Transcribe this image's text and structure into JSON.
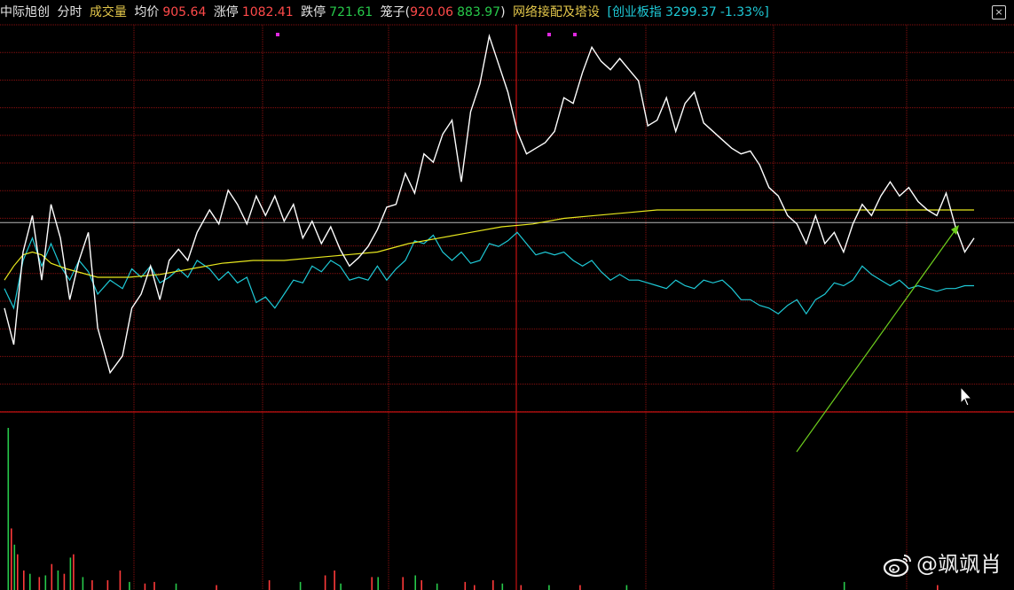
{
  "header": {
    "stock_name": "中际旭创",
    "tab_time": "分时",
    "tab_volume": "成交量",
    "avg_label": "均价",
    "avg_value": "905.64",
    "limit_up_label": "涨停",
    "limit_up_value": "1082.41",
    "limit_down_label": "跌停",
    "limit_down_value": "721.61",
    "cage_label": "笼子(",
    "cage_high": "920.06",
    "cage_low": "883.97",
    "cage_close": ")",
    "sector": "网络接配及塔设",
    "index_open": "[",
    "index_name": "创业板指",
    "index_value": "3299.37",
    "index_change": "-1.33%",
    "index_close": "]"
  },
  "colors": {
    "background": "#000000",
    "grid": "#8a1010",
    "price_line": "#ffffff",
    "avg_line": "#e8e81e",
    "index_line": "#1ec9d6",
    "vol_up": "#ff3a3a",
    "vol_down": "#27c94a",
    "arrow": "#6ecf1e",
    "marker": "#e028e0"
  },
  "chart_data": {
    "type": "line",
    "title": "",
    "xlabel": "",
    "ylabel": "",
    "grid": true,
    "x_count": 240,
    "y_range_price": [
      858,
      996
    ],
    "prev_close": 925.5,
    "series": [
      {
        "name": "",
        "kind": "price",
        "points": [
          [
            0,
            895
          ],
          [
            3,
            882
          ],
          [
            6,
            915
          ],
          [
            9,
            928
          ],
          [
            12,
            905
          ],
          [
            15,
            932
          ],
          [
            18,
            920
          ],
          [
            21,
            898
          ],
          [
            24,
            912
          ],
          [
            27,
            922
          ],
          [
            30,
            888
          ],
          [
            34,
            872
          ],
          [
            38,
            878
          ],
          [
            41,
            895
          ],
          [
            44,
            900
          ],
          [
            47,
            910
          ],
          [
            50,
            898
          ],
          [
            53,
            912
          ],
          [
            56,
            916
          ],
          [
            59,
            912
          ],
          [
            62,
            922
          ],
          [
            66,
            930
          ],
          [
            69,
            925
          ],
          [
            72,
            937
          ],
          [
            75,
            932
          ],
          [
            78,
            925
          ],
          [
            81,
            935
          ],
          [
            84,
            928
          ],
          [
            87,
            935
          ],
          [
            90,
            926
          ],
          [
            93,
            932
          ],
          [
            96,
            920
          ],
          [
            99,
            926
          ],
          [
            102,
            918
          ],
          [
            105,
            924
          ],
          [
            108,
            916
          ],
          [
            111,
            910
          ],
          [
            114,
            913
          ],
          [
            117,
            917
          ],
          [
            120,
            923
          ],
          [
            123,
            931
          ],
          [
            126,
            932
          ],
          [
            129,
            943
          ],
          [
            132,
            936
          ],
          [
            135,
            950
          ],
          [
            138,
            947
          ],
          [
            141,
            957
          ],
          [
            144,
            962
          ],
          [
            147,
            940
          ],
          [
            150,
            965
          ],
          [
            153,
            975
          ],
          [
            156,
            992
          ],
          [
            159,
            982
          ],
          [
            162,
            972
          ],
          [
            165,
            958
          ],
          [
            168,
            950
          ],
          [
            171,
            952
          ],
          [
            174,
            954
          ],
          [
            177,
            958
          ],
          [
            180,
            970
          ],
          [
            183,
            968
          ],
          [
            186,
            979
          ],
          [
            189,
            988
          ],
          [
            192,
            983
          ],
          [
            195,
            980
          ],
          [
            198,
            984
          ],
          [
            201,
            980
          ],
          [
            204,
            976
          ],
          [
            207,
            960
          ],
          [
            210,
            962
          ],
          [
            213,
            970
          ],
          [
            216,
            958
          ],
          [
            219,
            968
          ],
          [
            222,
            972
          ],
          [
            225,
            961
          ],
          [
            228,
            958
          ],
          [
            231,
            955
          ],
          [
            234,
            952
          ],
          [
            237,
            950
          ],
          [
            240,
            951
          ],
          [
            243,
            946
          ],
          [
            246,
            938
          ],
          [
            249,
            935
          ],
          [
            252,
            928
          ],
          [
            255,
            925
          ],
          [
            258,
            918
          ],
          [
            261,
            928
          ],
          [
            264,
            918
          ],
          [
            267,
            922
          ],
          [
            270,
            915
          ],
          [
            273,
            925
          ],
          [
            276,
            932
          ],
          [
            279,
            928
          ],
          [
            282,
            935
          ],
          [
            285,
            940
          ],
          [
            288,
            935
          ],
          [
            291,
            938
          ],
          [
            294,
            933
          ],
          [
            297,
            930
          ],
          [
            300,
            928
          ],
          [
            303,
            936
          ],
          [
            306,
            924
          ],
          [
            309,
            915
          ],
          [
            312,
            920
          ]
        ],
        "note_x_scale": 312
      },
      {
        "name": "",
        "kind": "avg",
        "points": [
          [
            0,
            905
          ],
          [
            3,
            910
          ],
          [
            6,
            914
          ],
          [
            9,
            915
          ],
          [
            12,
            914
          ],
          [
            15,
            911
          ],
          [
            20,
            909
          ],
          [
            30,
            906
          ],
          [
            40,
            906
          ],
          [
            50,
            907
          ],
          [
            60,
            909
          ],
          [
            70,
            911
          ],
          [
            80,
            912
          ],
          [
            90,
            912
          ],
          [
            100,
            913
          ],
          [
            110,
            914
          ],
          [
            120,
            915
          ],
          [
            130,
            918
          ],
          [
            140,
            920
          ],
          [
            150,
            922
          ],
          [
            160,
            924
          ],
          [
            170,
            925
          ],
          [
            180,
            927
          ],
          [
            190,
            928
          ],
          [
            200,
            929
          ],
          [
            210,
            930
          ],
          [
            220,
            930
          ],
          [
            230,
            930
          ],
          [
            240,
            930
          ],
          [
            250,
            930
          ],
          [
            260,
            930
          ],
          [
            270,
            930
          ],
          [
            280,
            930
          ],
          [
            290,
            930
          ],
          [
            300,
            930
          ],
          [
            312,
            930
          ]
        ],
        "note_x_scale": 312
      },
      {
        "name": "",
        "kind": "index",
        "points": [
          [
            0,
            902
          ],
          [
            3,
            895
          ],
          [
            6,
            912
          ],
          [
            9,
            920
          ],
          [
            12,
            910
          ],
          [
            15,
            918
          ],
          [
            18,
            910
          ],
          [
            21,
            905
          ],
          [
            24,
            912
          ],
          [
            27,
            908
          ],
          [
            30,
            900
          ],
          [
            34,
            905
          ],
          [
            38,
            902
          ],
          [
            41,
            909
          ],
          [
            44,
            906
          ],
          [
            47,
            910
          ],
          [
            50,
            904
          ],
          [
            53,
            906
          ],
          [
            56,
            909
          ],
          [
            59,
            906
          ],
          [
            62,
            912
          ],
          [
            66,
            909
          ],
          [
            69,
            905
          ],
          [
            72,
            908
          ],
          [
            75,
            904
          ],
          [
            78,
            906
          ],
          [
            81,
            897
          ],
          [
            84,
            899
          ],
          [
            87,
            895
          ],
          [
            90,
            900
          ],
          [
            93,
            905
          ],
          [
            96,
            904
          ],
          [
            99,
            910
          ],
          [
            102,
            908
          ],
          [
            105,
            912
          ],
          [
            108,
            910
          ],
          [
            111,
            905
          ],
          [
            114,
            906
          ],
          [
            117,
            905
          ],
          [
            120,
            910
          ],
          [
            123,
            905
          ],
          [
            126,
            909
          ],
          [
            129,
            912
          ],
          [
            132,
            919
          ],
          [
            135,
            918
          ],
          [
            138,
            921
          ],
          [
            141,
            915
          ],
          [
            144,
            912
          ],
          [
            147,
            915
          ],
          [
            150,
            911
          ],
          [
            153,
            912
          ],
          [
            156,
            918
          ],
          [
            159,
            917
          ],
          [
            162,
            919
          ],
          [
            165,
            922
          ],
          [
            168,
            918
          ],
          [
            171,
            914
          ],
          [
            174,
            915
          ],
          [
            177,
            914
          ],
          [
            180,
            915
          ],
          [
            183,
            912
          ],
          [
            186,
            910
          ],
          [
            189,
            912
          ],
          [
            192,
            908
          ],
          [
            195,
            905
          ],
          [
            198,
            907
          ],
          [
            201,
            905
          ],
          [
            204,
            905
          ],
          [
            207,
            904
          ],
          [
            210,
            903
          ],
          [
            213,
            902
          ],
          [
            216,
            905
          ],
          [
            219,
            903
          ],
          [
            222,
            902
          ],
          [
            225,
            905
          ],
          [
            228,
            904
          ],
          [
            231,
            905
          ],
          [
            234,
            902
          ],
          [
            237,
            898
          ],
          [
            240,
            898
          ],
          [
            243,
            896
          ],
          [
            246,
            895
          ],
          [
            249,
            893
          ],
          [
            252,
            896
          ],
          [
            255,
            898
          ],
          [
            258,
            893
          ],
          [
            261,
            898
          ],
          [
            264,
            900
          ],
          [
            267,
            904
          ],
          [
            270,
            903
          ],
          [
            273,
            905
          ],
          [
            276,
            910
          ],
          [
            279,
            907
          ],
          [
            282,
            905
          ],
          [
            285,
            903
          ],
          [
            288,
            905
          ],
          [
            291,
            902
          ],
          [
            294,
            903
          ],
          [
            297,
            902
          ],
          [
            300,
            901
          ],
          [
            303,
            902
          ],
          [
            306,
            902
          ],
          [
            309,
            903
          ],
          [
            312,
            903
          ]
        ],
        "note_x_scale": 312
      }
    ],
    "volume_series": [
      {
        "x": 1,
        "v": 100,
        "up": false
      },
      {
        "x": 2,
        "v": 38,
        "up": true
      },
      {
        "x": 3,
        "v": 28,
        "up": false
      },
      {
        "x": 4,
        "v": 22,
        "up": true
      },
      {
        "x": 6,
        "v": 12,
        "up": true
      },
      {
        "x": 8,
        "v": 10,
        "up": false
      },
      {
        "x": 11,
        "v": 8,
        "up": true
      },
      {
        "x": 13,
        "v": 9,
        "up": false
      },
      {
        "x": 15,
        "v": 16,
        "up": true
      },
      {
        "x": 17,
        "v": 12,
        "up": false
      },
      {
        "x": 19,
        "v": 10,
        "up": true
      },
      {
        "x": 21,
        "v": 20,
        "up": false
      },
      {
        "x": 22,
        "v": 22,
        "up": true
      },
      {
        "x": 25,
        "v": 8,
        "up": false
      },
      {
        "x": 28,
        "v": 6,
        "up": true
      },
      {
        "x": 33,
        "v": 6,
        "up": true
      },
      {
        "x": 37,
        "v": 12,
        "up": true
      },
      {
        "x": 40,
        "v": 5,
        "up": false
      },
      {
        "x": 45,
        "v": 4,
        "up": true
      },
      {
        "x": 48,
        "v": 5,
        "up": true
      },
      {
        "x": 55,
        "v": 4,
        "up": false
      },
      {
        "x": 68,
        "v": 3,
        "up": true
      },
      {
        "x": 85,
        "v": 6,
        "up": true
      },
      {
        "x": 95,
        "v": 5,
        "up": false
      },
      {
        "x": 103,
        "v": 9,
        "up": true
      },
      {
        "x": 106,
        "v": 12,
        "up": true
      },
      {
        "x": 108,
        "v": 4,
        "up": false
      },
      {
        "x": 118,
        "v": 8,
        "up": true
      },
      {
        "x": 120,
        "v": 8,
        "up": false
      },
      {
        "x": 128,
        "v": 8,
        "up": true
      },
      {
        "x": 132,
        "v": 9,
        "up": false
      },
      {
        "x": 134,
        "v": 6,
        "up": true
      },
      {
        "x": 139,
        "v": 4,
        "up": false
      },
      {
        "x": 148,
        "v": 5,
        "up": true
      },
      {
        "x": 151,
        "v": 3,
        "up": true
      },
      {
        "x": 157,
        "v": 6,
        "up": true
      },
      {
        "x": 160,
        "v": 4,
        "up": false
      },
      {
        "x": 166,
        "v": 3,
        "up": true
      },
      {
        "x": 175,
        "v": 3,
        "up": false
      },
      {
        "x": 185,
        "v": 3,
        "up": true
      },
      {
        "x": 200,
        "v": 3,
        "up": false
      },
      {
        "x": 270,
        "v": 5,
        "up": false
      },
      {
        "x": 300,
        "v": 3,
        "up": true
      }
    ],
    "volume_x_scale": 312,
    "volume_max": 100
  },
  "cursor_icon": "mouse-pointer-icon",
  "watermark": {
    "logo_icon": "weibo-logo-icon",
    "text": "@飒飒肖"
  }
}
